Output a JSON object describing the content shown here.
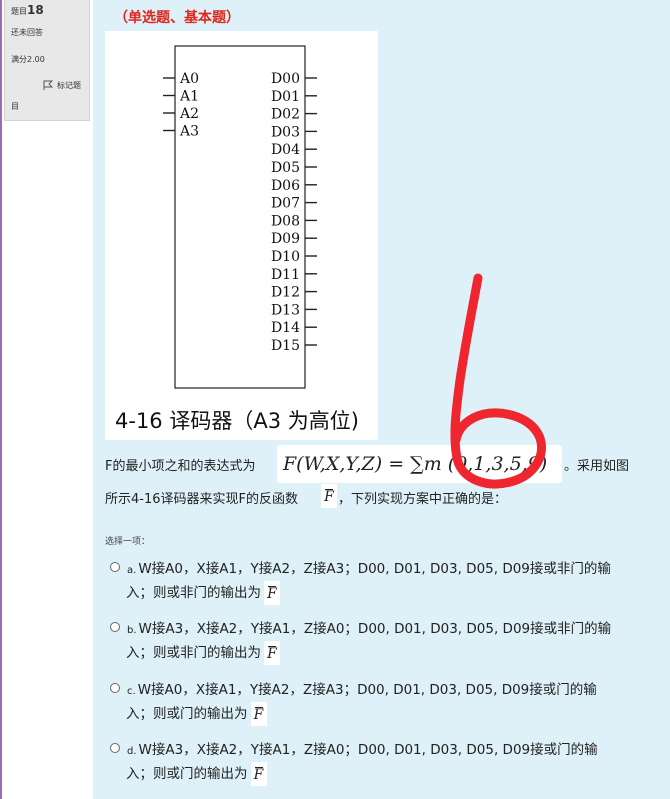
{
  "sidebar": {
    "question_prefix": "题目",
    "question_number": "18",
    "state": "还未回答",
    "grade": "满分2.00",
    "flag_label": "标记题",
    "flag_label_tail": "目"
  },
  "question": {
    "type_label": "（单选题、基本题）",
    "diagram": {
      "inputs": [
        "A0",
        "A1",
        "A2",
        "A3"
      ],
      "outputs": [
        "D00",
        "D01",
        "D02",
        "D03",
        "D04",
        "D05",
        "D06",
        "D07",
        "D08",
        "D09",
        "D10",
        "D11",
        "D12",
        "D13",
        "D14",
        "D15"
      ],
      "caption": "4-16 译码器（A3 为高位)"
    },
    "text_line1_before": "F的最小项之和的表达式为",
    "formula": "F(W,X,Y,Z) = ∑m (0,1,3,5,9)",
    "text_line1_after": "。采用如图",
    "text_line2_before": "所示4-16译码器来实现F的反函数",
    "fbar": "F",
    "text_line2_after": "，下列实现方案中正确的是：",
    "choose_label": "选择一项：",
    "options": [
      {
        "letter": "a.",
        "line1": "W接A0，X接A1，Y接A2，Z接A3；D00, D01, D03, D05, D09接或非门的输",
        "line2": "入；则或非门的输出为"
      },
      {
        "letter": "b.",
        "line1": "W接A3，X接A2，Y接A1，Z接A0；D00, D01, D03, D05, D09接或非门的输",
        "line2": "入；则或非门的输出为"
      },
      {
        "letter": "c.",
        "line1": "W接A0，X接A1，Y接A2，Z接A3；D00, D01, D03, D05, D09接或门的输",
        "line2": "入；则或门的输出为"
      },
      {
        "letter": "d.",
        "line1": "W接A3，X接A2，Y接A1，Z接A0；D00, D01, D03, D05, D09接或门的输",
        "line2": "入；则或门的输出为"
      }
    ]
  },
  "colors": {
    "content_bg": "#def0f8",
    "type_label": "#e0261a",
    "handwriting": "#f0262f",
    "sidebar_bg": "#e8e8e8"
  }
}
